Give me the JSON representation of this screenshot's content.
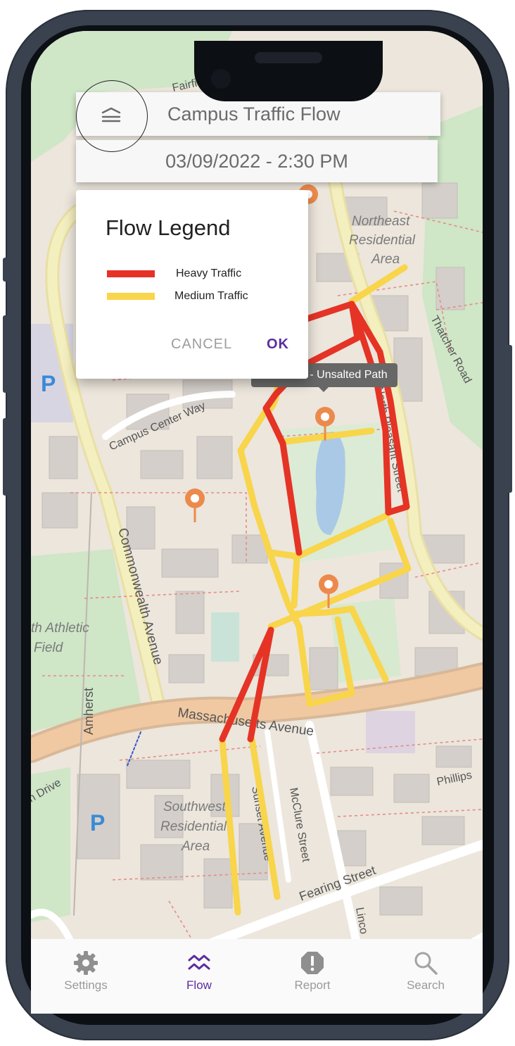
{
  "app": {
    "title": "Campus Traffic Flow",
    "datetime": "03/09/2022 -  2:30 PM",
    "menu_icon": "menu-layers-icon"
  },
  "legend_dialog": {
    "title": "Flow Legend",
    "items": [
      {
        "label": "Heavy Traffic",
        "color": "#e53326"
      },
      {
        "label": "Medium Traffic",
        "color": "#f8d54a"
      }
    ],
    "cancel_label": "CANCEL",
    "ok_label": "OK"
  },
  "map": {
    "tooltip": "Black Ice - Unsalted Path",
    "street_labels": {
      "fairfield": "Fairfield Street",
      "campus_center": "Campus Center Way",
      "commonwealth": "Commonwealth Avenue",
      "massachusetts": "Massachusetts Avenue",
      "thatcher": "Thatcher Road",
      "north_pleasant": "North Pleasant Street",
      "mcclure": "McClure Street",
      "sunset": "Sunset Avenue",
      "fearing": "Fearing Street",
      "amherst": "Amherst",
      "phillips": "Phillips",
      "lincoln": "Linco",
      "drive": "n Drive"
    },
    "area_labels": {
      "northeast": [
        "Northeast",
        "Residential",
        "Area"
      ],
      "southwest": [
        "Southwest",
        "Residential",
        "Area"
      ],
      "athletic": [
        "th Athletic",
        "Field"
      ]
    },
    "parking_label": "P",
    "colors": {
      "heavy": "#e53326",
      "medium": "#f8d54a",
      "pin": "#ec8a4c"
    }
  },
  "nav": {
    "items": [
      {
        "label": "Settings",
        "icon": "gear-icon",
        "active": false
      },
      {
        "label": "Flow",
        "icon": "flow-waves-icon",
        "active": true
      },
      {
        "label": "Report",
        "icon": "alert-icon",
        "active": false
      },
      {
        "label": "Search",
        "icon": "search-icon",
        "active": false
      }
    ],
    "active_color": "#5b2d9e",
    "inactive_color": "#9a9a9a"
  }
}
